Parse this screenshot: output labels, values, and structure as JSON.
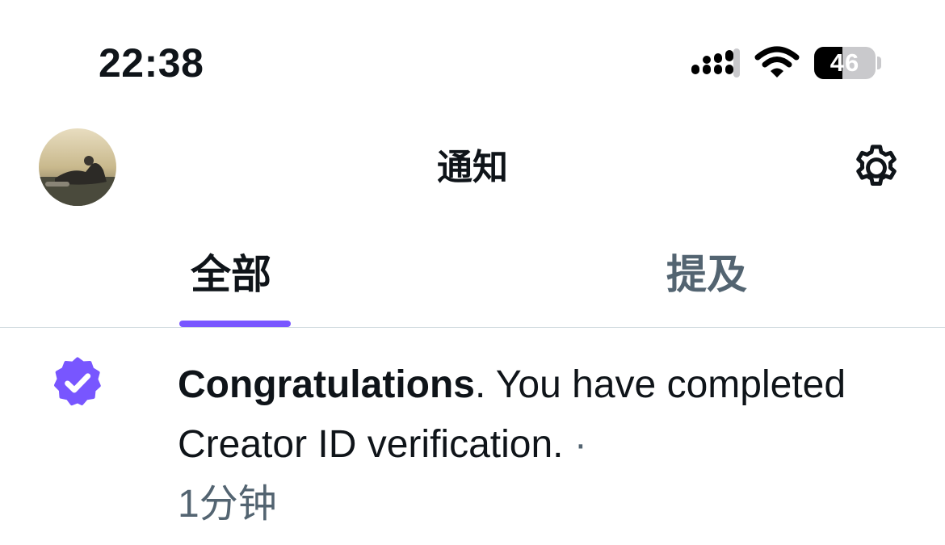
{
  "status_bar": {
    "time": "22:38",
    "battery_level": "46",
    "icons": [
      "cellular-signal-icon",
      "wifi-icon",
      "battery-icon"
    ]
  },
  "header": {
    "title": "通知",
    "avatar": "profile-avatar",
    "settings_icon": "gear-icon"
  },
  "tabs": [
    {
      "label": "全部",
      "active": true
    },
    {
      "label": "提及",
      "active": false
    }
  ],
  "notifications": [
    {
      "icon": "verified-badge-icon",
      "title": "Congratulations",
      "message": ".  You have completed Creator ID verification.",
      "separator": " · ",
      "time": "1分钟"
    }
  ],
  "colors": {
    "accent": "#7856ff",
    "text_primary": "#0f1419",
    "text_secondary": "#536471",
    "divider": "#cfd9de"
  }
}
